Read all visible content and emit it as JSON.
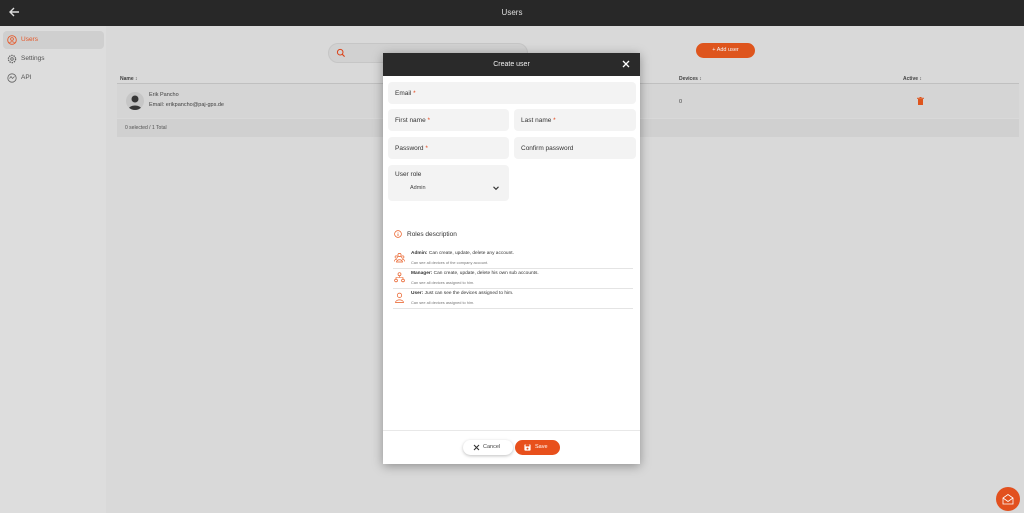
{
  "topbar": {
    "title": "Users"
  },
  "sidebar": {
    "items": [
      {
        "label": "Users",
        "icon": "users-icon",
        "active": true
      },
      {
        "label": "Settings",
        "icon": "gear-icon",
        "active": false
      },
      {
        "label": "API",
        "icon": "api-icon",
        "active": false
      }
    ]
  },
  "toolbar": {
    "add_user_label": "+ Add user"
  },
  "table": {
    "columns": {
      "name": "Name ↕",
      "devices": "Devices ↕",
      "active": "Active ↕"
    },
    "rows": [
      {
        "name": "Erik Pancho",
        "email": "Email: erikpancho@paj-gps.de",
        "devices": "0"
      }
    ],
    "footer": "0 selected / 1 Total"
  },
  "modal": {
    "title": "Create user",
    "fields": {
      "email": "Email",
      "first_name": "First name",
      "last_name": "Last name",
      "password": "Password",
      "confirm_password": "Confirm password",
      "required_mark": "*"
    },
    "user_role": {
      "label": "User role",
      "value": "Admin"
    },
    "roles_title": "Roles description",
    "roles": [
      {
        "name": "Admin:",
        "line1": " Can create, update, delete any account.",
        "line2": "Can see all devices of the company account."
      },
      {
        "name": "Manager:",
        "line1": " Can create, update, delete his own sub accounts.",
        "line2": "Can see all devices assigned to him."
      },
      {
        "name": "User:",
        "line1": " Just can see the devices assigned to him.",
        "line2": "Can see all devices assigned to him."
      }
    ],
    "cancel_label": "Cancel",
    "save_label": "Save"
  },
  "colors": {
    "accent": "#e8501c",
    "topbar": "#2a2a2a"
  }
}
